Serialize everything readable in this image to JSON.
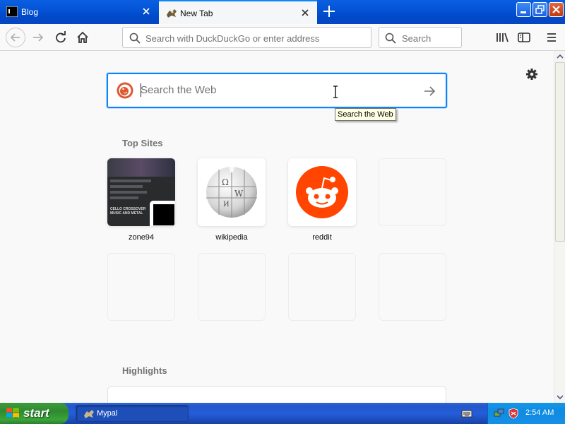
{
  "browser": {
    "tabs": [
      {
        "label": "Blog",
        "active": false,
        "favicon": "terminal-icon"
      },
      {
        "label": "New Tab",
        "active": true,
        "favicon": "mypal-icon"
      }
    ],
    "urlbar": {
      "placeholder": "Search with DuckDuckGo or enter address",
      "value": ""
    },
    "searchbar": {
      "placeholder": "Search",
      "value": ""
    }
  },
  "newtab": {
    "websearch": {
      "placeholder": "Search the Web",
      "value": "",
      "tooltip": "Search the Web",
      "engine_icon": "duckduckgo-icon"
    },
    "top_sites_title": "Top Sites",
    "top_sites": [
      {
        "label": "zone94"
      },
      {
        "label": "wikipedia"
      },
      {
        "label": "reddit"
      }
    ],
    "zone94_preview_text": "CELLO CROSSOVER MUSIC AND METAL",
    "highlights_title": "Highlights"
  },
  "taskbar": {
    "start_label": "start",
    "task": {
      "label": "Mypal"
    },
    "clock": "2:54 AM"
  },
  "colors": {
    "accent": "#0a84ff",
    "titlebar": "#0454d6",
    "reddit": "#ff4500",
    "taskbar": "#245edb",
    "start": "#3aa43a"
  }
}
